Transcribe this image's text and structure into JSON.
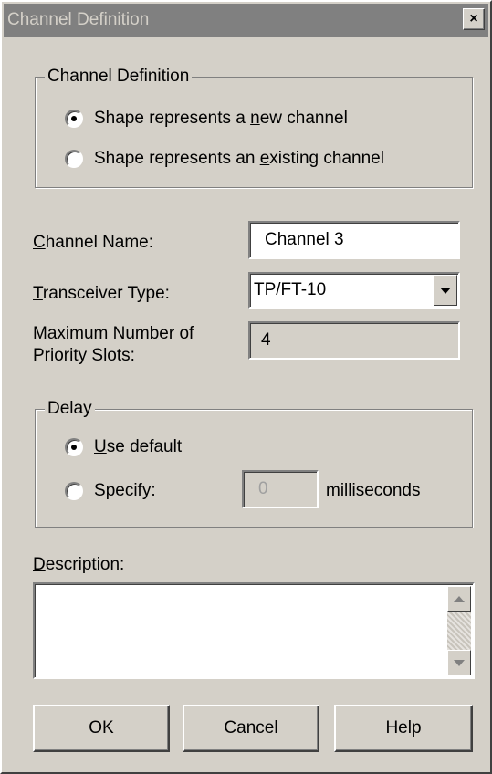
{
  "window": {
    "title": "Channel Definition",
    "close_glyph": "×"
  },
  "channel_group": {
    "legend": "Channel Definition",
    "options": [
      {
        "label_pre": "Shape represents a ",
        "mnemonic": "n",
        "label_post": "ew channel",
        "checked": true
      },
      {
        "label_pre": "Shape represents an ",
        "mnemonic": "e",
        "label_post": "xisting channel",
        "checked": false
      }
    ]
  },
  "fields": {
    "channel_name": {
      "mnemonic": "C",
      "label_rest": "hannel Name:",
      "value": "Channel 3"
    },
    "transceiver": {
      "mnemonic": "T",
      "label_rest": "ransceiver Type:",
      "value": "TP/FT-10"
    },
    "priority": {
      "mnemonic": "M",
      "label_rest": "aximum  Number of",
      "label_line2": "Priority Slots:",
      "value": "4"
    }
  },
  "delay_group": {
    "legend": "Delay",
    "use_default": {
      "mnemonic": "U",
      "label_rest": "se default",
      "checked": true
    },
    "specify": {
      "mnemonic": "S",
      "label_rest": "pecify:",
      "checked": false,
      "value": "0",
      "unit": "milliseconds"
    }
  },
  "description": {
    "mnemonic": "D",
    "label_rest": "escription:",
    "value": ""
  },
  "buttons": {
    "ok": "OK",
    "cancel": "Cancel",
    "help": "Help"
  },
  "icons": {
    "dropdown": "chevron-down-icon",
    "scroll_up": "scroll-up-icon",
    "scroll_down": "scroll-down-icon",
    "close": "close-icon"
  }
}
